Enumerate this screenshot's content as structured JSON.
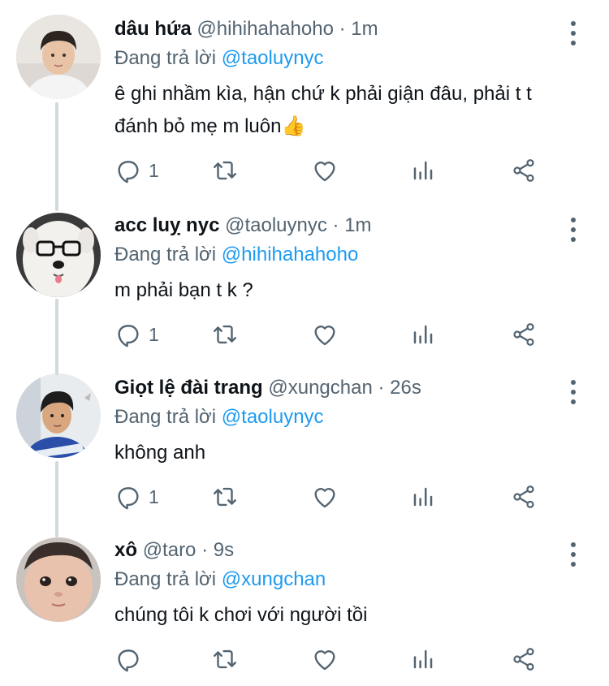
{
  "thread": {
    "tweets": [
      {
        "name": "dâu hứa",
        "handle": "@hihihahahoho",
        "separator": "·",
        "time": "1m",
        "reply_prefix": "Đang trả lời",
        "reply_to": "@taoluynyc",
        "text_line1": "ê ghi nhầm kìa, hận chứ k phải giận đâu, phải t t",
        "text_line2": "đánh bỏ mẹ m luôn👍",
        "reply_count": "1"
      },
      {
        "name": "acc luỵ nyc",
        "handle": "@taoluynyc",
        "separator": "·",
        "time": "1m",
        "reply_prefix": "Đang trả lời",
        "reply_to": "@hihihahahoho",
        "text_line1": "m phải bạn t k ?",
        "reply_count": "1"
      },
      {
        "name": "Giọt lệ đài trang",
        "handle": "@xungchan",
        "separator": "·",
        "time": "26s",
        "reply_prefix": "Đang trả lời",
        "reply_to": "@taoluynyc",
        "text_line1": "không anh",
        "reply_count": "1"
      },
      {
        "name": "xô",
        "handle": "@taro",
        "separator": "·",
        "time": "9s",
        "reply_prefix": "Đang trả lời",
        "reply_to": "@xungchan",
        "text_line1": "chúng tôi k chơi với người tồi",
        "reply_count": ""
      }
    ]
  },
  "icons": {
    "reply": "reply-icon",
    "retweet": "retweet-icon",
    "like": "heart-icon",
    "stats": "stats-icon",
    "share": "share-icon",
    "more": "more-vertical-icon"
  },
  "colors": {
    "link": "#1d9bf0",
    "secondary": "#536471",
    "text": "#0f1419",
    "connector": "#cfd9de"
  }
}
